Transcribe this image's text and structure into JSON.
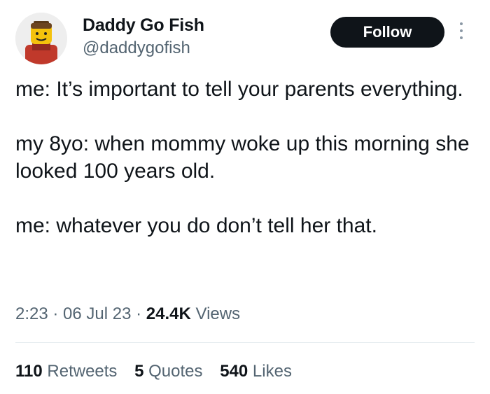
{
  "author": {
    "display_name": "Daddy Go Fish",
    "handle": "@daddygofish"
  },
  "actions": {
    "follow_label": "Follow",
    "more_icon": "more-vertical-icon"
  },
  "tweet": {
    "paragraphs": [
      "me: It’s important to tell your parents everything.",
      "my 8yo: when mommy woke up this morning she looked 100 years old.",
      "me: whatever you do don’t tell her that."
    ],
    "time": "2:23",
    "separator": " · ",
    "date": "06 Jul 23",
    "views_count": "24.4K",
    "views_label": "Views"
  },
  "stats": {
    "retweets_count": "110",
    "retweets_label": "Retweets",
    "quotes_count": "5",
    "quotes_label": "Quotes",
    "likes_count": "540",
    "likes_label": "Likes"
  },
  "colors": {
    "text": "#0f1419",
    "secondary": "#536471",
    "button": "#0f1419"
  }
}
